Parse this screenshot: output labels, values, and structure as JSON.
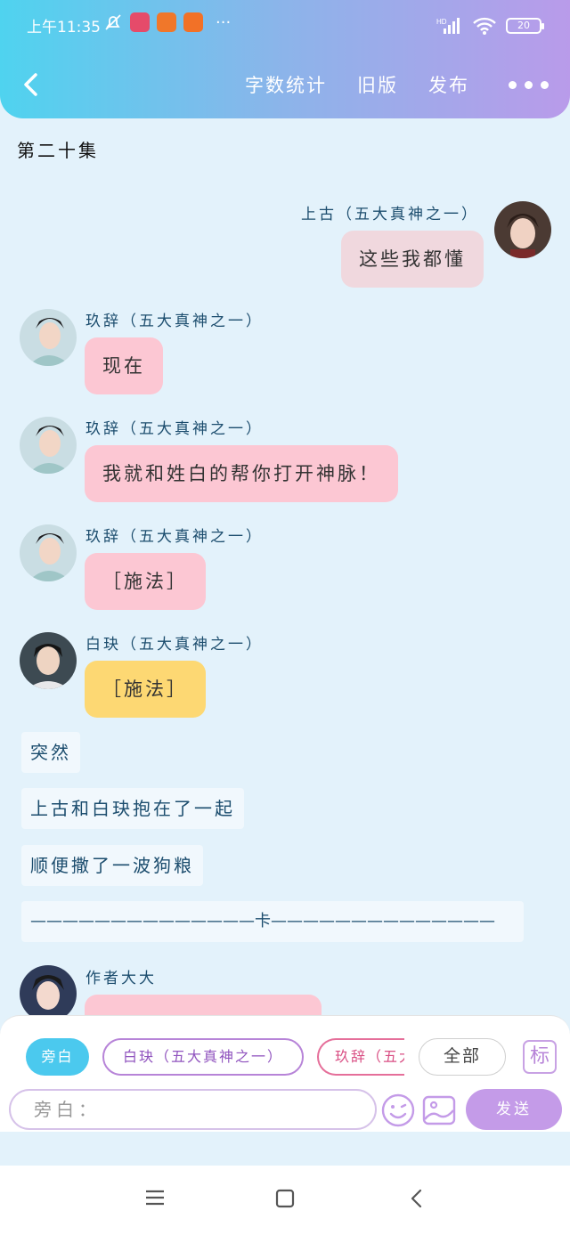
{
  "status": {
    "time": "上午11:35",
    "battery": "20",
    "signal": "HD",
    "more": "···"
  },
  "toolbar": {
    "word_count": "字数统计",
    "old_version": "旧版",
    "publish": "发布"
  },
  "episode": "第二十集",
  "messages": [
    {
      "speaker": "上古（五大真神之一）",
      "text": "这些我都懂"
    },
    {
      "speaker": "玖辞（五大真神之一）",
      "text": "现在"
    },
    {
      "speaker": "玖辞（五大真神之一）",
      "text": "我就和姓白的帮你打开神脉！"
    },
    {
      "speaker": "玖辞（五大真神之一）",
      "text": "［施法］"
    },
    {
      "speaker": "白玦（五大真神之一）",
      "text": "［施法］"
    },
    {
      "speaker": "作者大大",
      "text": ""
    }
  ],
  "narrations": [
    "突然",
    "上古和白玦抱在了一起",
    "顺便撒了一波狗粮",
    "——————————————卡——————————————"
  ],
  "composer": {
    "chips": [
      "旁白",
      "白玦（五大真神之一）",
      "玖辞（五大真神之一）",
      "全部"
    ],
    "mark": "标",
    "input_placeholder": "旁白：",
    "send": "发送"
  },
  "colors": {
    "header_gradient": [
      "#4fd3ef",
      "#b99bea"
    ],
    "bubble_pink": "#fcc7d3",
    "bubble_yellow": "#fdd873",
    "send_button": "#c49be8",
    "active_chip": "#4bc9ee"
  }
}
